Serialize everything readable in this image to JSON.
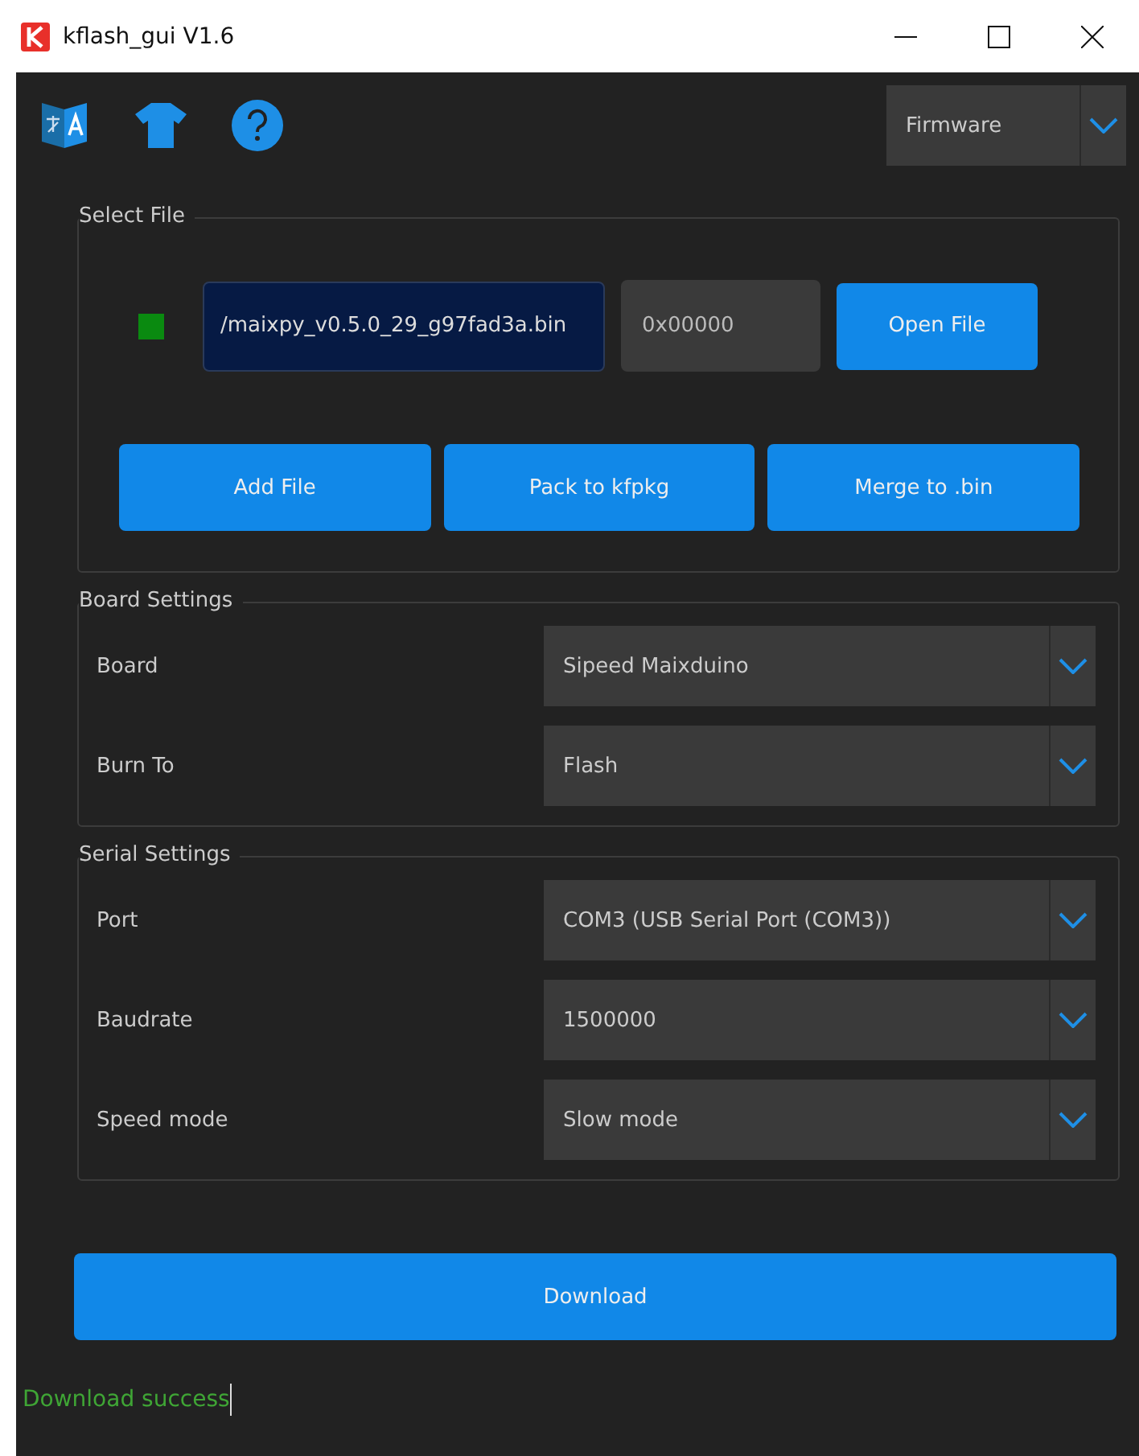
{
  "window": {
    "title": "kflash_gui V1.6"
  },
  "mode_select": {
    "value": "Firmware"
  },
  "select_file": {
    "title": "Select File",
    "file": {
      "checked": true,
      "path": "/maixpy_v0.5.0_29_g97fad3a.bin",
      "address": "0x00000"
    },
    "open_button": "Open File",
    "buttons": [
      "Add File",
      "Pack to kfpkg",
      "Merge to .bin"
    ]
  },
  "groups": [
    {
      "title": "Board Settings",
      "rows": [
        {
          "label": "Board",
          "value": "Sipeed Maixduino"
        },
        {
          "label": "Burn To",
          "value": "Flash"
        }
      ]
    },
    {
      "title": "Serial Settings",
      "rows": [
        {
          "label": "Port",
          "value": "COM3 (USB Serial Port (COM3))"
        },
        {
          "label": "Baudrate",
          "value": "1500000"
        },
        {
          "label": "Speed mode",
          "value": "Slow mode"
        }
      ]
    }
  ],
  "download_button": "Download",
  "status": "Download success"
}
